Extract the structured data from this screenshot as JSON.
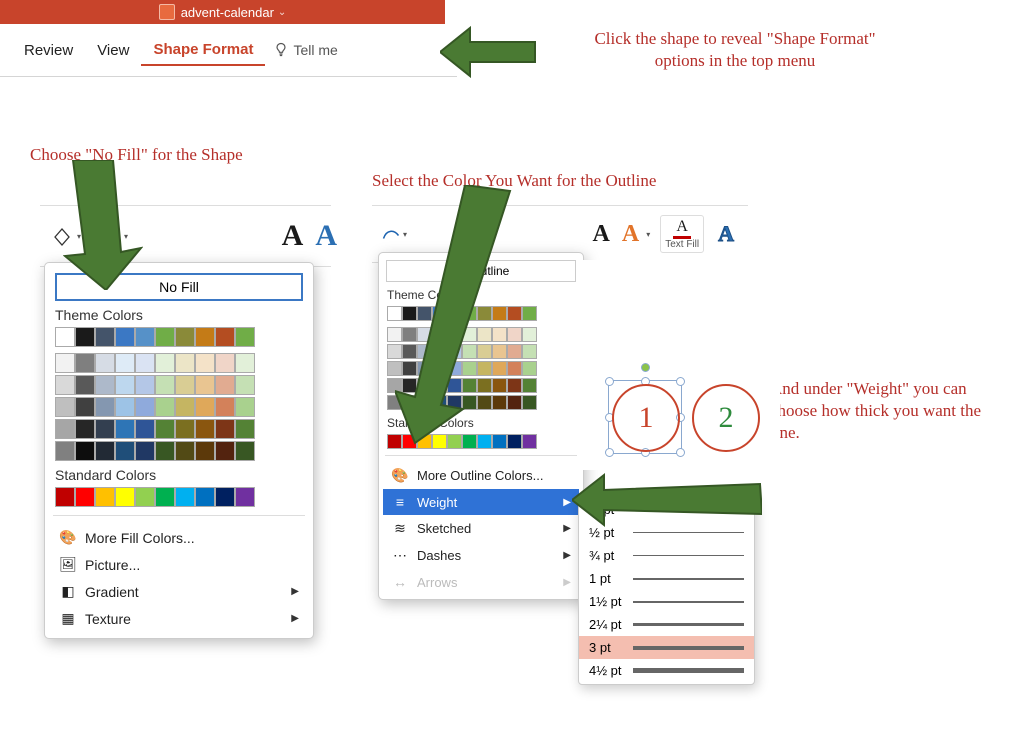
{
  "titlebar": {
    "filename": "advent-calendar"
  },
  "ribbon": {
    "tabs": [
      "Review",
      "View",
      "Shape Format"
    ],
    "tell_me": "Tell me"
  },
  "annotations": {
    "top": "Click the shape to reveal \"Shape Format\" options in the top menu",
    "nofill": "Choose \"No Fill\" for the Shape",
    "outline": "Select the Color You Want for the Outline",
    "weight": "And under \"Weight\" you can choose how thick you want the line."
  },
  "fill_panel": {
    "no_fill": "No Fill",
    "theme_label": "Theme Colors",
    "standard_label": "Standard Colors",
    "more": "More Fill Colors...",
    "picture": "Picture...",
    "gradient": "Gradient",
    "texture": "Texture"
  },
  "outline_panel": {
    "no_outline": "No Outline",
    "theme_label": "Theme Colors",
    "standard_label": "Standard Colors",
    "more": "More Outline Colors...",
    "weight": "Weight",
    "sketched": "Sketched",
    "dashes": "Dashes",
    "arrows": "Arrows"
  },
  "textfill_label": "Text Fill",
  "theme_colors_row": [
    "#ffffff",
    "#1a1a1a",
    "#44546a",
    "#3b78c4",
    "#5691c8",
    "#70ad47",
    "#8a8a39",
    "#c47b17",
    "#b44d21",
    "#70ad47"
  ],
  "theme_shades": [
    [
      "#f2f2f2",
      "#d9d9d9",
      "#bfbfbf",
      "#a6a6a6",
      "#808080"
    ],
    [
      "#7f7f7f",
      "#595959",
      "#404040",
      "#262626",
      "#0d0d0d"
    ],
    [
      "#d6dce5",
      "#adb9ca",
      "#8497b0",
      "#333f50",
      "#222a35"
    ],
    [
      "#deebf7",
      "#bdd7ee",
      "#9dc3e6",
      "#2e75b6",
      "#1f4e79"
    ],
    [
      "#dae3f3",
      "#b4c7e7",
      "#8faadc",
      "#2f5597",
      "#203864"
    ],
    [
      "#e2f0d9",
      "#c5e0b4",
      "#a9d18e",
      "#548235",
      "#385723"
    ],
    [
      "#ece5c7",
      "#d9cd94",
      "#c5b562",
      "#7b6f20",
      "#524a15"
    ],
    [
      "#f4e2c8",
      "#e9c591",
      "#dfa85a",
      "#8a560f",
      "#5c390a"
    ],
    [
      "#f0d5c8",
      "#e1ab91",
      "#d3815a",
      "#7d3517",
      "#53230f"
    ],
    [
      "#e2f0d9",
      "#c5e0b4",
      "#a9d18e",
      "#548235",
      "#385723"
    ]
  ],
  "standard_colors": [
    "#c00000",
    "#ff0000",
    "#ffc000",
    "#ffff00",
    "#92d050",
    "#00b050",
    "#00b0f0",
    "#0070c0",
    "#002060",
    "#7030a0"
  ],
  "weights": [
    {
      "label": "¼ pt",
      "px": 1
    },
    {
      "label": "½ pt",
      "px": 1
    },
    {
      "label": "¾ pt",
      "px": 1.5
    },
    {
      "label": "1 pt",
      "px": 2
    },
    {
      "label": "1½ pt",
      "px": 2.5
    },
    {
      "label": "2¼ pt",
      "px": 3
    },
    {
      "label": "3 pt",
      "px": 4,
      "selected": true
    },
    {
      "label": "4½ pt",
      "px": 5
    }
  ],
  "slide": {
    "c1": "1",
    "c2": "2"
  }
}
